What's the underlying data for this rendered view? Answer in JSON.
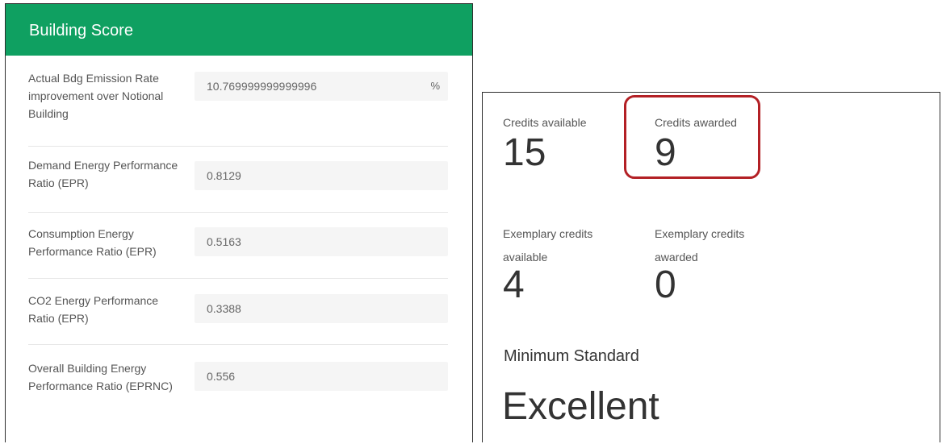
{
  "building_score": {
    "title": "Building Score",
    "fields": [
      {
        "label": "Actual Bdg Emission Rate improvement over Notional Building",
        "value": "10.769999999999996",
        "unit": "%"
      },
      {
        "label": "Demand Energy Performance Ratio (EPR)",
        "value": "0.8129"
      },
      {
        "label": "Consumption Energy Performance Ratio (EPR)",
        "value": "0.5163"
      },
      {
        "label": "CO2 Energy Performance Ratio (EPR)",
        "value": "0.3388"
      },
      {
        "label": "Overall Building Energy Performance Ratio (EPRNC)",
        "value": "0.556"
      }
    ]
  },
  "credits": {
    "available_label": "Credits available",
    "available_value": "15",
    "awarded_label": "Credits awarded",
    "awarded_value": "9",
    "exemplary_available_label": "Exemplary credits available",
    "exemplary_available_value": "4",
    "exemplary_awarded_label": "Exemplary credits awarded",
    "exemplary_awarded_value": "0",
    "minimum_standard_label": "Minimum Standard",
    "minimum_standard_value": "Excellent"
  },
  "colors": {
    "header_green": "#0fa061",
    "highlight_red": "#b32025"
  }
}
